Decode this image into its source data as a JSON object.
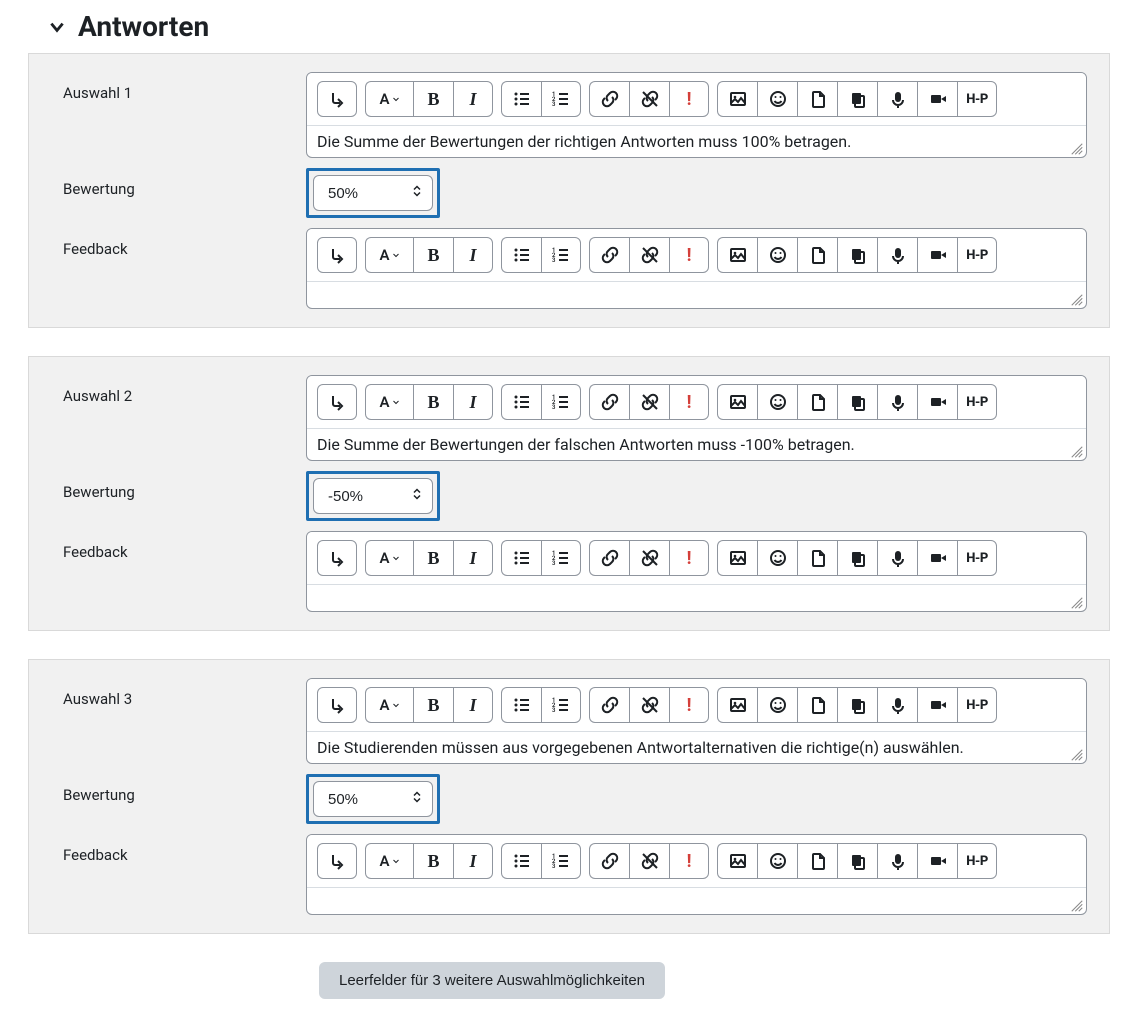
{
  "section_title": "Antworten",
  "labels": {
    "bewertung": "Bewertung",
    "feedback": "Feedback"
  },
  "choices": [
    {
      "label": "Auswahl 1",
      "content": "Die Summe der Bewertungen der richtigen Antworten muss 100% betragen.",
      "grade": "50%",
      "feedback": ""
    },
    {
      "label": "Auswahl 2",
      "content": "Die Summe der Bewertungen der falschen Antworten muss -100% betragen.",
      "grade": "-50%",
      "feedback": ""
    },
    {
      "label": "Auswahl 3",
      "content": "Die Studierenden müssen aus vorgegebenen Antwortalternativen die richtige(n) auswählen.",
      "grade": "50%",
      "feedback": ""
    }
  ],
  "grade_options": [
    "50%",
    "-50%"
  ],
  "blanks_button": "Leerfelder für 3 weitere Auswahlmöglichkeiten",
  "toolbar_font_letter": "A"
}
